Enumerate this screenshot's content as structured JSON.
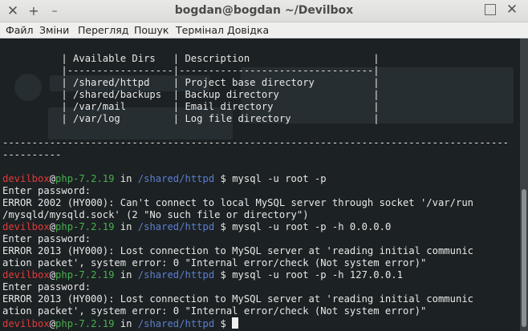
{
  "window": {
    "title": "bogdan@bogdan ~/Devilbox",
    "icons": {
      "close": "close-icon",
      "new_tab": "plus-icon",
      "minimize": "minimize-icon",
      "maximize": "maximize-icon",
      "close_right": "close-icon"
    }
  },
  "menu": [
    "Файл",
    "Зміни",
    "Перегляд",
    "Пошук",
    "Термінал",
    "Довідка"
  ],
  "table": {
    "header": "          | Available Dirs   | Description                     |",
    "separator": "          |------------------|---------------------------------|",
    "rows": [
      "          | /shared/httpd    | Project base directory          |",
      "          | /shared/backups  | Backup directory                |",
      "          | /var/mail        | Email directory                 |",
      "          | /var/log         | Log file directory              |"
    ]
  },
  "divider1": "--------------------------------------------------------------------------------------",
  "divider2": "----------",
  "prompt": {
    "host": "devilbox",
    "at": "@",
    "php": "php-7.2.19",
    "in": " in ",
    "dir": "/shared/httpd",
    "dollar": " $ "
  },
  "session": [
    {
      "cmd": "mysql -u root -p",
      "out": [
        "Enter password:",
        "ERROR 2002 (HY000): Can't connect to local MySQL server through socket '/var/run",
        "/mysqld/mysqld.sock' (2 \"No such file or directory\")"
      ]
    },
    {
      "cmd": "mysql -u root -p -h 0.0.0.0",
      "out": [
        "Enter password:",
        "ERROR 2013 (HY000): Lost connection to MySQL server at 'reading initial communic",
        "ation packet', system error: 0 \"Internal error/check (Not system error)\""
      ]
    },
    {
      "cmd": "mysql -u root -p -h 127.0.0.1",
      "out": [
        "Enter password:",
        "ERROR 2013 (HY000): Lost connection to MySQL server at 'reading initial communic",
        "ation packet', system error: 0 \"Internal error/check (Not system error)\""
      ]
    }
  ]
}
